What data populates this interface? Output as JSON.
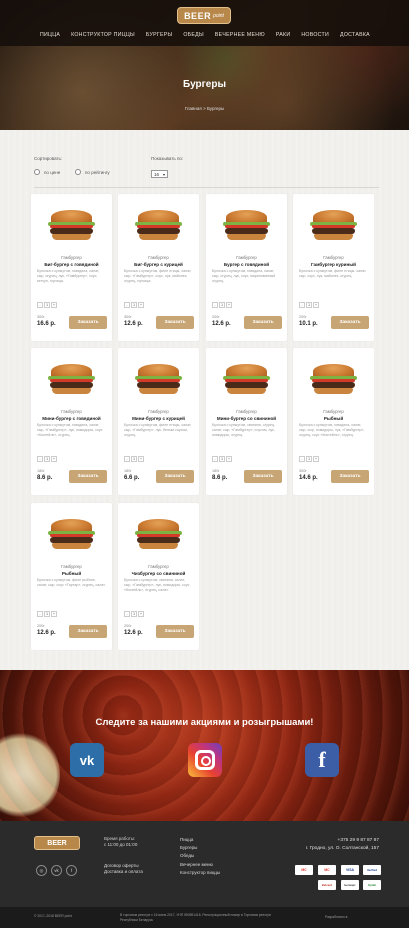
{
  "header": {
    "logo_text": "BEER",
    "logo_sub": "point",
    "nav": [
      "ПИЦЦА",
      "КОНСТРУКТОР ПИЦЦЫ",
      "БУРГЕРЫ",
      "ОБЕДЫ",
      "ВЕЧЕРНЕЕ МЕНЮ",
      "РАКИ",
      "НОВОСТИ",
      "ДОСТАВКА"
    ],
    "page_title": "Бургеры",
    "breadcrumb": "Главная  >  Бургеры"
  },
  "filters": {
    "sort_label": "Сортировать:",
    "sort_options": [
      "по цене",
      "по рейтингу"
    ],
    "perpage_label": "Показывать по:",
    "perpage_value": "16"
  },
  "products": [
    {
      "category": "Гамбургер",
      "name": "Биг-бургер с говядиной",
      "desc": "Булочка с кунжутом, говядина, салат, сыр, огурец, лук, «Гамбургер», соус, кетчуп, горчица.",
      "qty": "1",
      "weight": "300г",
      "price": "16.6 р.",
      "order": "Заказать"
    },
    {
      "category": "Гамбургер",
      "name": "Биг-бургер с курицей",
      "desc": "Булочка с кунжутом, филе птицы, салат, сыр, «Гамбургер», соус, лук, майонез, огурец, горчица.",
      "qty": "1",
      "weight": "300г",
      "price": "12.6 р.",
      "order": "Заказать"
    },
    {
      "category": "Гамбургер",
      "name": "Бургер с говядиной",
      "desc": "Булочка с кунжутом, говядина, салат, сыр, огурец, лук, соус, маринованный огурец.",
      "qty": "1",
      "weight": "200г",
      "price": "12.6 р.",
      "order": "Заказать"
    },
    {
      "category": "Гамбургер",
      "name": "Гамбургер куриный",
      "desc": "Булочка с кунжутом, филе птицы, салат, сыр, соус, лук, майонез, огурец.",
      "qty": "1",
      "weight": "200г",
      "price": "10.1 р.",
      "order": "Заказать"
    },
    {
      "category": "Гамбургер",
      "name": "Мини-бургер с говядиной",
      "desc": "Булочка с кунжутом, говядина, салат, сыр, «Гамбургер», лук, помидоры, соус «Коктейль», огурец.",
      "qty": "1",
      "weight": "180г",
      "price": "8.6 р.",
      "order": "Заказать"
    },
    {
      "category": "Гамбургер",
      "name": "Мини-бургер с курицей",
      "desc": "Булочка с кунжутом, филе птицы, салат, сыр, «Гамбургер», лук, белым соусом, огурец.",
      "qty": "1",
      "weight": "180г",
      "price": "6.6 р.",
      "order": "Заказать"
    },
    {
      "category": "Гамбургер",
      "name": "Мини-бургер со свининой",
      "desc": "Булочка с кунжутом, свинина, огурец, салат, сыр, «Гамбургер», соусом, лук, помидоры, огурец.",
      "qty": "1",
      "weight": "180г",
      "price": "8.6 р.",
      "order": "Заказать"
    },
    {
      "category": "Гамбургер",
      "name": "Рыбный",
      "desc": "Булочка с кунжутом, говядина, салат, сыр, сыр, помидоры, лук, «Гамбургер», огурец, соус «Коктейль», огурец.",
      "qty": "1",
      "weight": "300г",
      "price": "14.6 р.",
      "order": "Заказать"
    },
    {
      "category": "Гамбургер",
      "name": "Рыбный",
      "desc": "Булочка с кунжутом, филе рыбное, салат, сыр, соус «Тартар», огурец, салат.",
      "qty": "1",
      "weight": "200г",
      "price": "12.6 р.",
      "order": "Заказать"
    },
    {
      "category": "Гамбургер",
      "name": "Чизбургер со свининой",
      "desc": "Булочка с кунжутом, свинина, салат, сыр, «Гамбургер», лук, помидоры, соус «Коктейль», огурец, салат.",
      "qty": "1",
      "weight": "200г",
      "price": "12.6 р.",
      "order": "Заказать"
    }
  ],
  "promo": {
    "title": "Следите за нашими акциями и розыгрышами!",
    "socials": [
      "vk-icon",
      "instagram-icon",
      "facebook-icon"
    ]
  },
  "footer": {
    "logo_text": "BEER",
    "hours_title": "Время работы:",
    "hours": "с 11:00 до 01:00",
    "links": [
      "Договор оферты",
      "Доставка и оплата"
    ],
    "menu": [
      "Пицца",
      "Бургеры",
      "Обеды",
      "Вечернее меню",
      "Конструктор пиццы"
    ],
    "phone": "+375 29 9 87 87 87",
    "address": "г. Гродно, ул. О. Солтанской, 157",
    "payments": [
      "MC",
      "MC",
      "VISA",
      "Verified",
      "Belcard",
      "Белкарт",
      "Oplati"
    ],
    "copyright": "© 2017–2018 BEER point",
    "legal": "В торговом реестре с 16 июня 2017, УНП 590891418. Регистрационный номер в Торговом реестре Республики Беларусь",
    "dev": "Разработано в"
  },
  "colors": {
    "accent": "#c7a574",
    "dark": "#2b2b2b",
    "vk": "#2d6ea8",
    "facebook": "#3b5ea6"
  }
}
